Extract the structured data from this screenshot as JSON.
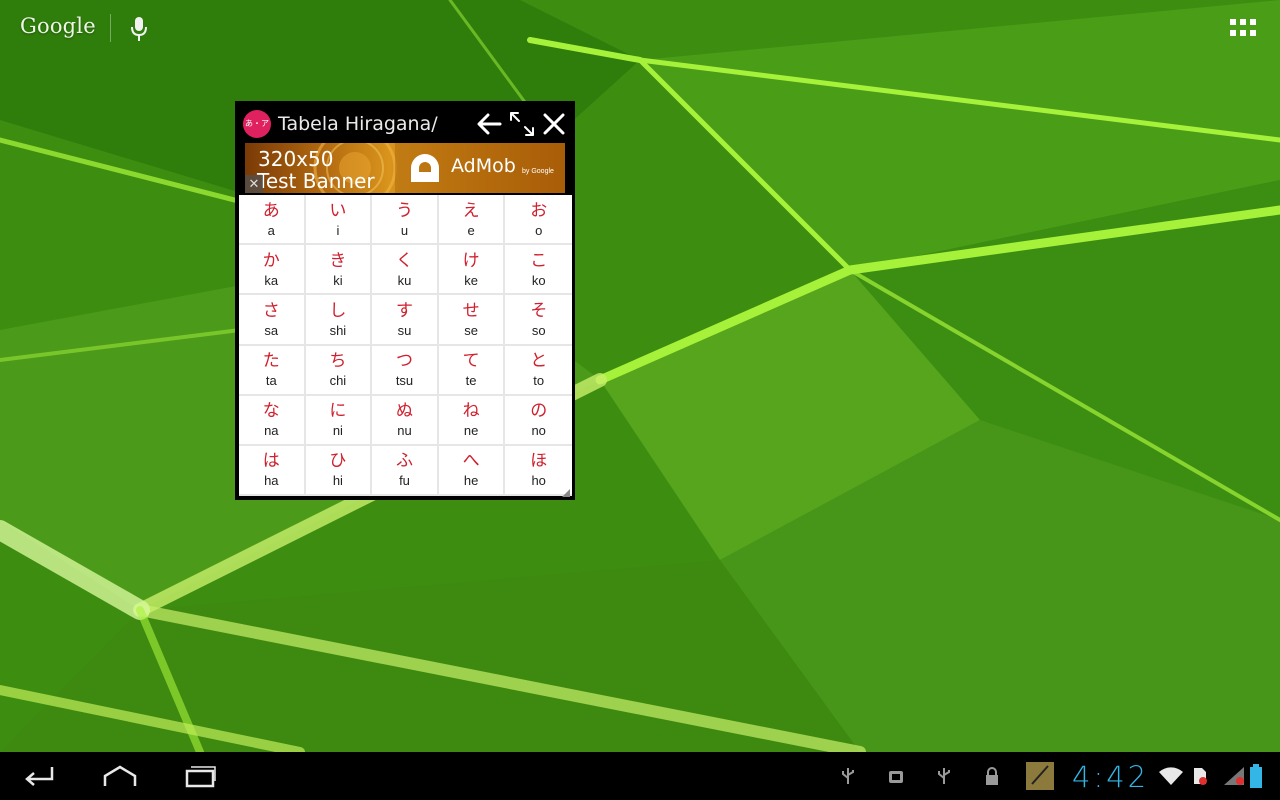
{
  "search_bar": {
    "logo_text": "Google"
  },
  "floating_window": {
    "app_icon_text": "あ・ア",
    "title": "Tabela Hiragana/",
    "ad": {
      "line1": "320x50",
      "line2": "Test Banner",
      "close_glyph": "✕",
      "brand": "AdMob",
      "by": "by Google"
    }
  },
  "kana_rows": [
    [
      {
        "kana": "あ",
        "romaji": "a"
      },
      {
        "kana": "い",
        "romaji": "i"
      },
      {
        "kana": "う",
        "romaji": "u"
      },
      {
        "kana": "え",
        "romaji": "e"
      },
      {
        "kana": "お",
        "romaji": "o"
      }
    ],
    [
      {
        "kana": "か",
        "romaji": "ka"
      },
      {
        "kana": "き",
        "romaji": "ki"
      },
      {
        "kana": "く",
        "romaji": "ku"
      },
      {
        "kana": "け",
        "romaji": "ke"
      },
      {
        "kana": "こ",
        "romaji": "ko"
      }
    ],
    [
      {
        "kana": "さ",
        "romaji": "sa"
      },
      {
        "kana": "し",
        "romaji": "shi"
      },
      {
        "kana": "す",
        "romaji": "su"
      },
      {
        "kana": "せ",
        "romaji": "se"
      },
      {
        "kana": "そ",
        "romaji": "so"
      }
    ],
    [
      {
        "kana": "た",
        "romaji": "ta"
      },
      {
        "kana": "ち",
        "romaji": "chi"
      },
      {
        "kana": "つ",
        "romaji": "tsu"
      },
      {
        "kana": "て",
        "romaji": "te"
      },
      {
        "kana": "と",
        "romaji": "to"
      }
    ],
    [
      {
        "kana": "な",
        "romaji": "na"
      },
      {
        "kana": "に",
        "romaji": "ni"
      },
      {
        "kana": "ぬ",
        "romaji": "nu"
      },
      {
        "kana": "ね",
        "romaji": "ne"
      },
      {
        "kana": "の",
        "romaji": "no"
      }
    ],
    [
      {
        "kana": "は",
        "romaji": "ha"
      },
      {
        "kana": "ひ",
        "romaji": "hi"
      },
      {
        "kana": "ふ",
        "romaji": "fu"
      },
      {
        "kana": "へ",
        "romaji": "he"
      },
      {
        "kana": "ほ",
        "romaji": "ho"
      }
    ]
  ],
  "status_bar": {
    "clock": "4:42"
  },
  "colors": {
    "wallpaper_base": "#3f8f12",
    "kana_red": "#d0202e",
    "clock_blue": "#33b5e5",
    "app_icon_pink": "#e0215f"
  },
  "icons": {
    "mic": "mic-icon",
    "apps": "all-apps-icon",
    "back": "arrow-left-icon",
    "expand": "expand-icon",
    "close": "close-icon",
    "nav": [
      "nav-back-icon",
      "nav-home-icon",
      "nav-recent-apps-icon"
    ],
    "status": [
      "usb-icon",
      "android-debug-icon",
      "usb-icon",
      "lock-icon",
      "notes-icon",
      "wifi-icon",
      "sim-icon",
      "signal-icon",
      "battery-icon"
    ]
  }
}
